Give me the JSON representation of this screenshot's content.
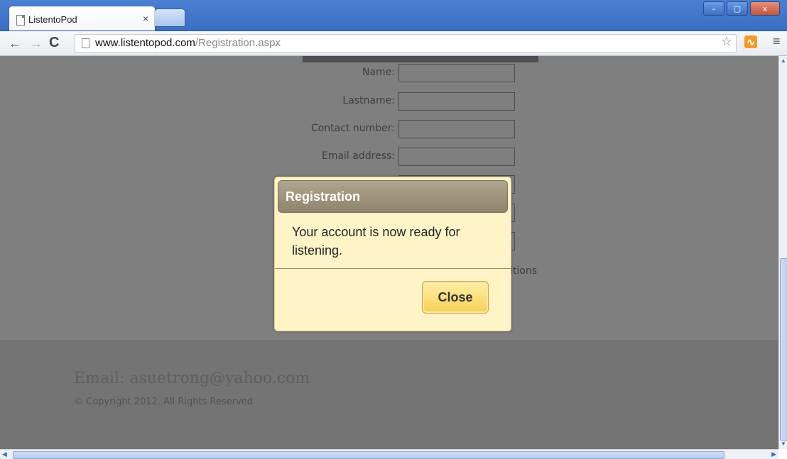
{
  "browser": {
    "tab_title": "ListentoPod",
    "tab_close": "×",
    "url_host": "www.listentopod.com",
    "url_path": "/Registration.aspx",
    "window_buttons": {
      "minimize": "–",
      "restore": "▢",
      "close": "x"
    },
    "icons": {
      "back": "back-arrow-icon",
      "forward": "forward-arrow-icon",
      "reload": "reload-icon",
      "bookmark": "star-icon",
      "rss": "rss-icon",
      "menu": "menu-icon"
    }
  },
  "form": {
    "fields": [
      {
        "label": "Name:",
        "value": ""
      },
      {
        "label": "Lastname:",
        "value": ""
      },
      {
        "label": "Contact number:",
        "value": ""
      },
      {
        "label": "Email address:",
        "value": ""
      }
    ],
    "terms_fragment": "itions"
  },
  "footer": {
    "email": "Email: asuetrong@yahoo.com",
    "copyright": "© Copyright 2012. All Rights Reserved"
  },
  "dialog": {
    "title": "Registration",
    "message": "Your account is now ready for listening.",
    "close_label": "Close"
  },
  "colors": {
    "dialog_background": "#fff4c8",
    "dialog_titlebar": "#9c917a",
    "close_button": "#f8dc77",
    "titlebar_blue": "#3a6ec4"
  }
}
